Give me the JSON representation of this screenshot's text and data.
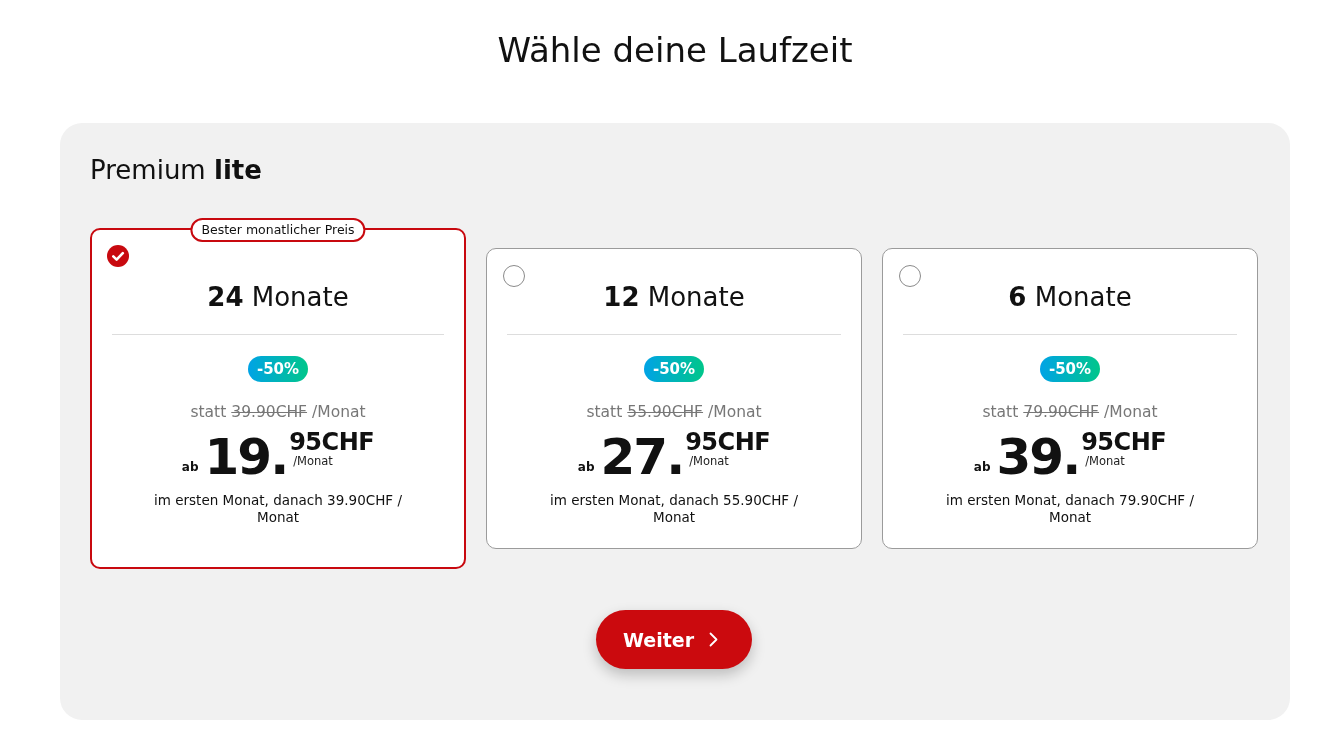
{
  "page": {
    "title": "Wähle deine Laufzeit"
  },
  "plan": {
    "name": "Premium **lite**"
  },
  "options": [
    {
      "selected": true,
      "duration": "**24** Monate",
      "best_price_badge": "Bester monatlicher Preis",
      "discount": "-50%",
      "old_price": {
        "prefix": "statt",
        "amount": "39.90CHF",
        "suffix": "/Monat"
      },
      "price": {
        "prefix": "ab",
        "whole": "19.",
        "cents": "95CHF",
        "period": "/Monat"
      },
      "note": "im ersten Monat, danach 39.90CHF / Monat"
    },
    {
      "selected": false,
      "duration": "**12** Monate",
      "discount": "-50%",
      "old_price": {
        "prefix": "statt",
        "amount": "55.90CHF",
        "suffix": "/Monat"
      },
      "price": {
        "prefix": "ab",
        "whole": "27.",
        "cents": "95CHF",
        "period": "/Monat"
      },
      "note": "im ersten Monat, danach 55.90CHF / Monat"
    },
    {
      "selected": false,
      "duration": "**6** Monate",
      "discount": "-50%",
      "old_price": {
        "prefix": "statt",
        "amount": "79.90CHF",
        "suffix": "/Monat"
      },
      "price": {
        "prefix": "ab",
        "whole": "39.",
        "cents": "95CHF",
        "period": "/Monat"
      },
      "note": "im ersten Monat, danach 79.90CHF / Monat"
    }
  ],
  "next_button": {
    "label": "Weiter"
  }
}
